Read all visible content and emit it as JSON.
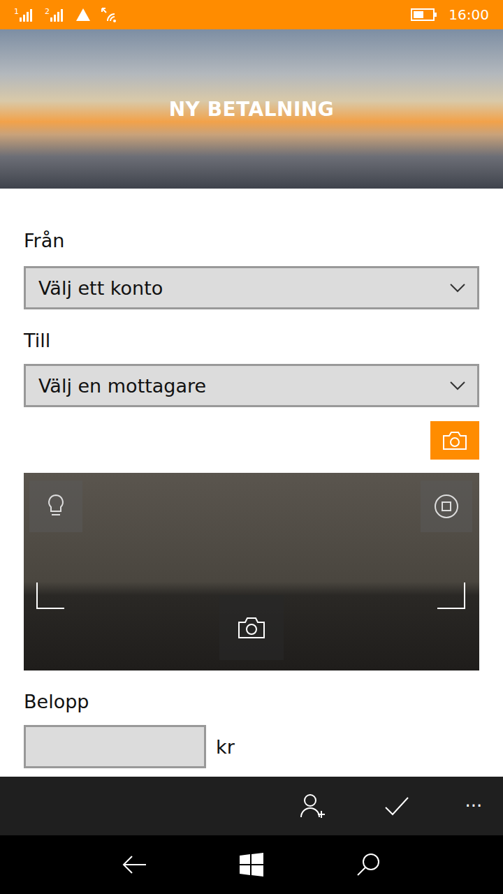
{
  "status_bar": {
    "sim1": "1",
    "sim2": "2",
    "time": "16:00"
  },
  "header": {
    "title": "NY BETALNING"
  },
  "form": {
    "from": {
      "label": "Från",
      "placeholder": "Välj ett konto"
    },
    "to": {
      "label": "Till",
      "placeholder": "Välj en mottagare"
    },
    "amount": {
      "label": "Belopp",
      "value": "",
      "unit": "kr"
    }
  },
  "app_bar": {
    "more": "···"
  }
}
